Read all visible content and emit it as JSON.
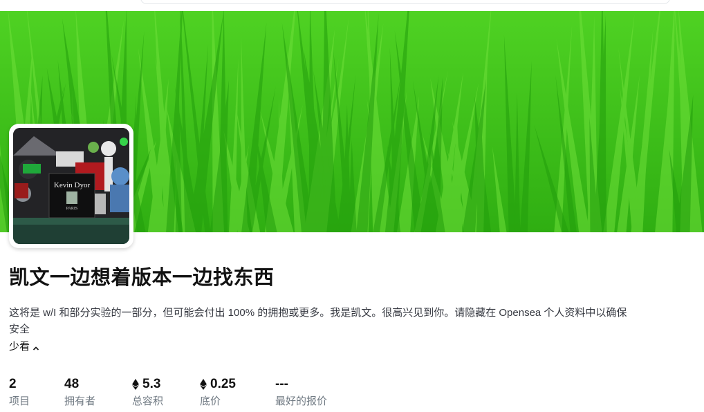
{
  "collection": {
    "title": "凯文一边想着版本一边找东西",
    "description": "这将是 w/I 和部分实验的一部分，但可能会付出 100% 的拥抱或更多。我是凯文。很高兴见到你。请隐藏在 Opensea 个人资料中以确保安全",
    "toggle_label": "少看",
    "avatar_text": "Kevin Dyor",
    "avatar_subtext": "PARIS"
  },
  "stats": [
    {
      "value": "2",
      "label": "项目",
      "eth": false
    },
    {
      "value": "48",
      "label": "拥有者",
      "eth": false
    },
    {
      "value": "5.3",
      "label": "总容积",
      "eth": true
    },
    {
      "value": "0.25",
      "label": "底价",
      "eth": true
    },
    {
      "value": "---",
      "label": "最好的报价",
      "eth": false
    }
  ],
  "colors": {
    "banner_green": "#3dbb1a",
    "text_primary": "#121212",
    "text_secondary": "#707a83"
  }
}
